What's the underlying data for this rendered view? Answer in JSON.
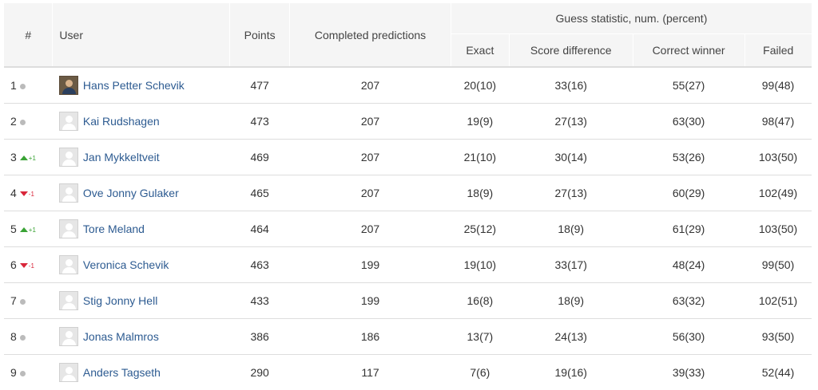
{
  "headers": {
    "rank": "#",
    "user": "User",
    "points": "Points",
    "completed": "Completed predictions",
    "guess_group": "Guess statistic, num. (percent)",
    "exact": "Exact",
    "score_difference": "Score difference",
    "correct_winner": "Correct winner",
    "failed": "Failed"
  },
  "colors": {
    "up": "#3aa335",
    "down": "#d9263a",
    "link": "#2d5b91",
    "header_bg": "#f5f5f5"
  },
  "rows": [
    {
      "rank": "1",
      "trend": "same",
      "change": "",
      "avatar": "photo",
      "name": "Hans Petter Schevik",
      "points": "477",
      "completed": "207",
      "exact": "20(10)",
      "score_diff": "33(16)",
      "correct_winner": "55(27)",
      "failed": "99(48)"
    },
    {
      "rank": "2",
      "trend": "same",
      "change": "",
      "avatar": "default",
      "name": "Kai Rudshagen",
      "points": "473",
      "completed": "207",
      "exact": "19(9)",
      "score_diff": "27(13)",
      "correct_winner": "63(30)",
      "failed": "98(47)"
    },
    {
      "rank": "3",
      "trend": "up",
      "change": "+1",
      "avatar": "default",
      "name": "Jan Mykkeltveit",
      "points": "469",
      "completed": "207",
      "exact": "21(10)",
      "score_diff": "30(14)",
      "correct_winner": "53(26)",
      "failed": "103(50)"
    },
    {
      "rank": "4",
      "trend": "down",
      "change": "-1",
      "avatar": "default",
      "name": "Ove Jonny Gulaker",
      "points": "465",
      "completed": "207",
      "exact": "18(9)",
      "score_diff": "27(13)",
      "correct_winner": "60(29)",
      "failed": "102(49)"
    },
    {
      "rank": "5",
      "trend": "up",
      "change": "+1",
      "avatar": "default",
      "name": "Tore Meland",
      "points": "464",
      "completed": "207",
      "exact": "25(12)",
      "score_diff": "18(9)",
      "correct_winner": "61(29)",
      "failed": "103(50)"
    },
    {
      "rank": "6",
      "trend": "down",
      "change": "-1",
      "avatar": "default",
      "name": "Veronica Schevik",
      "points": "463",
      "completed": "199",
      "exact": "19(10)",
      "score_diff": "33(17)",
      "correct_winner": "48(24)",
      "failed": "99(50)"
    },
    {
      "rank": "7",
      "trend": "same",
      "change": "",
      "avatar": "default",
      "name": "Stig Jonny Hell",
      "points": "433",
      "completed": "199",
      "exact": "16(8)",
      "score_diff": "18(9)",
      "correct_winner": "63(32)",
      "failed": "102(51)"
    },
    {
      "rank": "8",
      "trend": "same",
      "change": "",
      "avatar": "default",
      "name": "Jonas Malmros",
      "points": "386",
      "completed": "186",
      "exact": "13(7)",
      "score_diff": "24(13)",
      "correct_winner": "56(30)",
      "failed": "93(50)"
    },
    {
      "rank": "9",
      "trend": "same",
      "change": "",
      "avatar": "default",
      "name": "Anders Tagseth",
      "points": "290",
      "completed": "117",
      "exact": "7(6)",
      "score_diff": "19(16)",
      "correct_winner": "39(33)",
      "failed": "52(44)"
    }
  ]
}
